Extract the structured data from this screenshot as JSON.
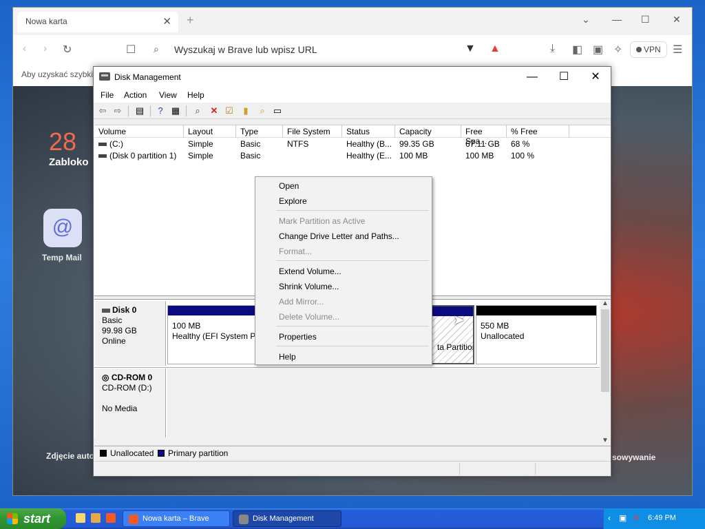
{
  "browser": {
    "tab_title": "Nowa karta",
    "url_placeholder": "Wyszukaj w Brave lub wpisz URL",
    "vpn_label": "VPN",
    "bookmarks_hint": "Aby uzyskać szybki d",
    "clock": "28",
    "city": "Zabloko",
    "tile_label": "Temp Mail",
    "photo_credit": "Zdjęcie auto",
    "sync_text": "sowywanie"
  },
  "dm": {
    "title": "Disk Management",
    "menu": [
      "File",
      "Action",
      "View",
      "Help"
    ],
    "columns": [
      "Volume",
      "Layout",
      "Type",
      "File System",
      "Status",
      "Capacity",
      "Free Spa...",
      "% Free"
    ],
    "volumes": [
      {
        "name": "(C:)",
        "layout": "Simple",
        "type": "Basic",
        "fs": "NTFS",
        "status": "Healthy (B...",
        "capacity": "99.35 GB",
        "free": "67.11 GB",
        "pct": "68 %"
      },
      {
        "name": "(Disk 0 partition 1)",
        "layout": "Simple",
        "type": "Basic",
        "fs": "",
        "status": "Healthy (E...",
        "capacity": "100 MB",
        "free": "100 MB",
        "pct": "100 %"
      }
    ],
    "disk0": {
      "name": "Disk 0",
      "type": "Basic",
      "size": "99.98 GB",
      "state": "Online"
    },
    "disk0_parts": [
      {
        "size": "100 MB",
        "desc": "Healthy (EFI System P"
      },
      {
        "size": "",
        "desc": "ta Partitior"
      },
      {
        "size": "550 MB",
        "desc": "Unallocated"
      }
    ],
    "cdrom": {
      "name": "CD-ROM 0",
      "drive": "CD-ROM (D:)",
      "media": "No Media"
    },
    "legend": {
      "unallocated": "Unallocated",
      "primary": "Primary partition"
    },
    "colors": {
      "unallocated": "#000000",
      "primary": "#0b0b80"
    }
  },
  "context_menu": {
    "items": [
      "Open",
      "Explore",
      "Mark Partition as Active",
      "Change Drive Letter and Paths...",
      "Format...",
      "Extend Volume...",
      "Shrink Volume...",
      "Add Mirror...",
      "Delete Volume...",
      "Properties",
      "Help"
    ],
    "disabled": [
      false,
      false,
      true,
      false,
      true,
      false,
      false,
      true,
      true,
      false,
      false
    ]
  },
  "taskbar": {
    "start": "start",
    "task_browser": "Nowa karta – Brave",
    "task_dm": "Disk Management",
    "clock": "6:49 PM"
  }
}
